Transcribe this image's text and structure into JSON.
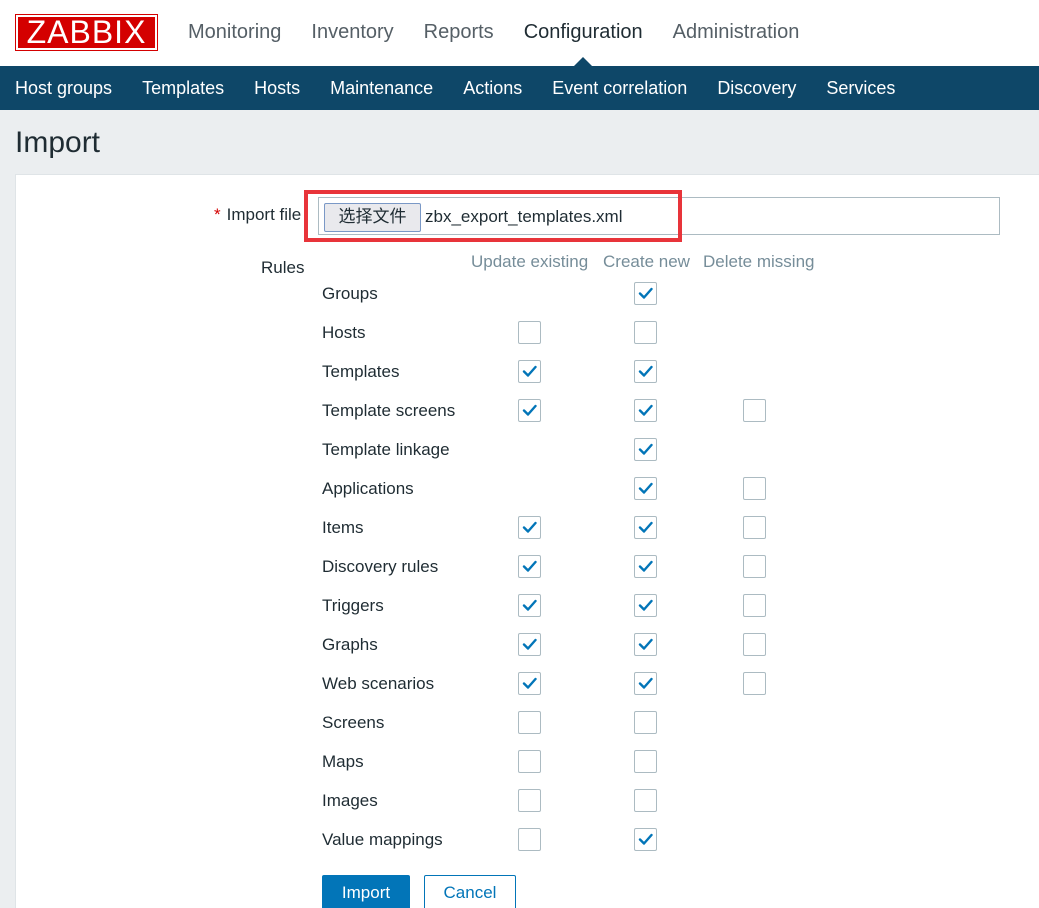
{
  "logo": "ZABBIX",
  "top_menu": [
    "Monitoring",
    "Inventory",
    "Reports",
    "Configuration",
    "Administration"
  ],
  "top_menu_active": "Configuration",
  "sub_menu": [
    "Host groups",
    "Templates",
    "Hosts",
    "Maintenance",
    "Actions",
    "Event correlation",
    "Discovery",
    "Services"
  ],
  "page_title": "Import",
  "form": {
    "required_mark": "*",
    "import_file_label": "Import file",
    "choose_file_button": "选择文件",
    "file_name": "zbx_export_templates.xml",
    "rules_label": "Rules",
    "columns": [
      "Update existing",
      "Create new",
      "Delete missing"
    ]
  },
  "rules": [
    {
      "name": "Groups",
      "update": null,
      "create": true,
      "delete": null
    },
    {
      "name": "Hosts",
      "update": false,
      "create": false,
      "delete": null
    },
    {
      "name": "Templates",
      "update": true,
      "create": true,
      "delete": null
    },
    {
      "name": "Template screens",
      "update": true,
      "create": true,
      "delete": false
    },
    {
      "name": "Template linkage",
      "update": null,
      "create": true,
      "delete": null
    },
    {
      "name": "Applications",
      "update": null,
      "create": true,
      "delete": false
    },
    {
      "name": "Items",
      "update": true,
      "create": true,
      "delete": false
    },
    {
      "name": "Discovery rules",
      "update": true,
      "create": true,
      "delete": false
    },
    {
      "name": "Triggers",
      "update": true,
      "create": true,
      "delete": false
    },
    {
      "name": "Graphs",
      "update": true,
      "create": true,
      "delete": false
    },
    {
      "name": "Web scenarios",
      "update": true,
      "create": true,
      "delete": false
    },
    {
      "name": "Screens",
      "update": false,
      "create": false,
      "delete": null
    },
    {
      "name": "Maps",
      "update": false,
      "create": false,
      "delete": null
    },
    {
      "name": "Images",
      "update": false,
      "create": false,
      "delete": null
    },
    {
      "name": "Value mappings",
      "update": false,
      "create": true,
      "delete": null
    }
  ],
  "buttons": {
    "import": "Import",
    "cancel": "Cancel"
  },
  "colors": {
    "brand_red": "#d40000",
    "nav_blue": "#0e4768",
    "accent_blue": "#0275b8",
    "highlight_red": "#e8343a"
  }
}
